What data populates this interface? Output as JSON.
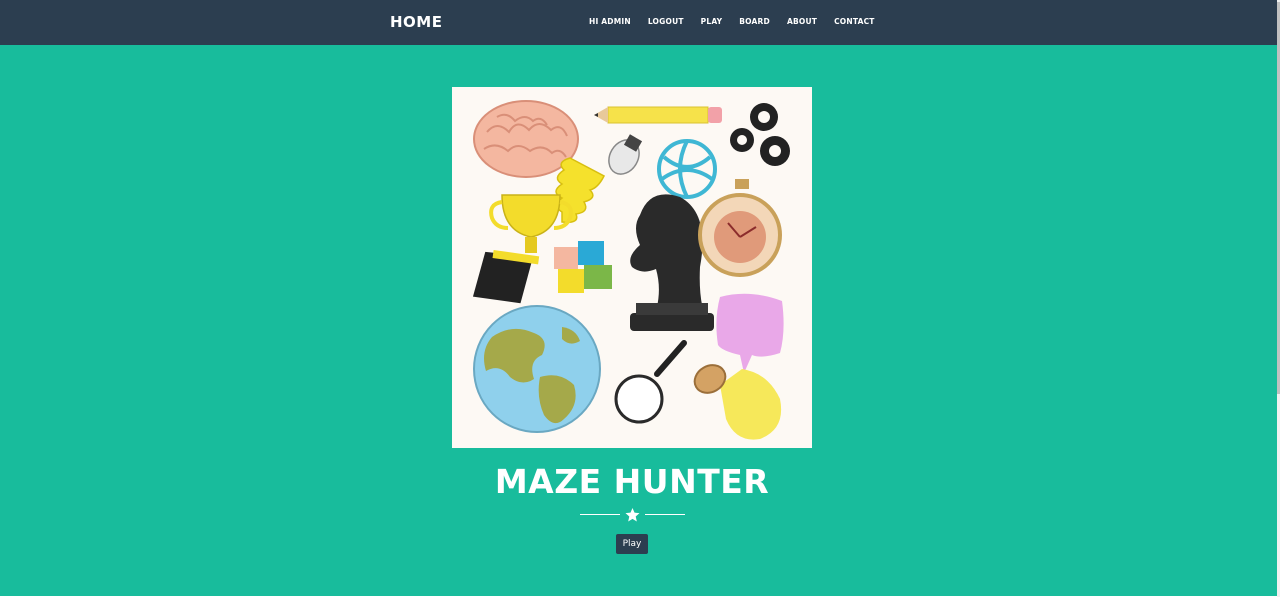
{
  "nav": {
    "brand": "HOME",
    "links": [
      "HI ADMIN",
      "LOGOUT",
      "PLAY",
      "BOARD",
      "ABOUT",
      "CONTACT"
    ]
  },
  "hero": {
    "title": "MAZE HUNTER",
    "divider_icon": "star-icon",
    "play_button": "Play"
  },
  "colors": {
    "navbar": "#2c3e50",
    "masthead": "#18bc9c",
    "button": "#2c3e50",
    "text": "#ffffff"
  }
}
